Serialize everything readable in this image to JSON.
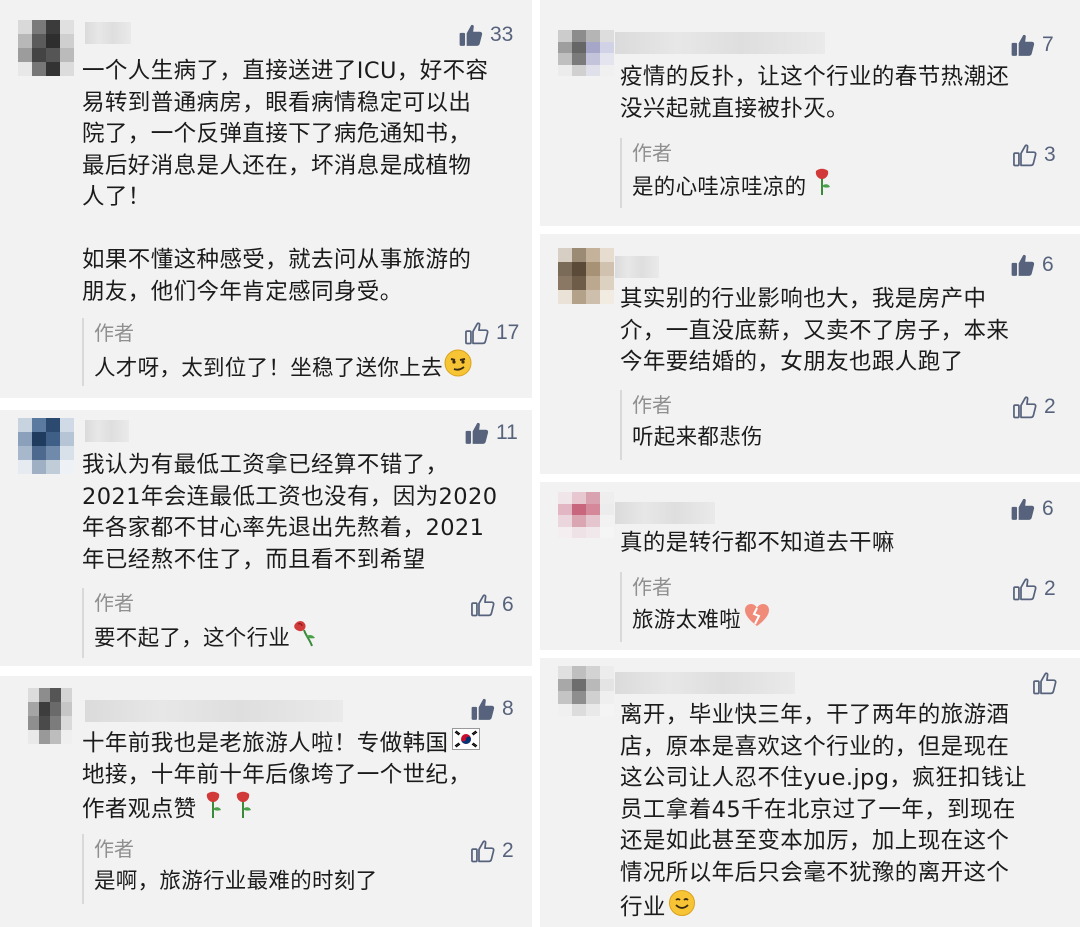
{
  "comments": [
    {
      "likes": "33",
      "lines": [
        "一个人生病了，直接送进了ICU，好不容",
        "易转到普通病房，眼看病情稳定可以出",
        "院了，一个反弹直接下了病危通知书，",
        "最后好消息是人还在，坏消息是成植物",
        "人了！",
        "",
        "如果不懂这种感受，就去问从事旅游的",
        "朋友，他们今年肯定感同身受。"
      ],
      "reply": {
        "author": "作者",
        "text": "人才呀，太到位了！坐稳了送你上去",
        "likes": "17"
      }
    },
    {
      "likes": "11",
      "lines": [
        "我认为有最低工资拿已经算不错了，",
        "2021年会连最低工资也没有，因为2020",
        "年各家都不甘心率先退出先熬着，2021",
        "年已经熬不住了，而且看不到希望"
      ],
      "reply": {
        "author": "作者",
        "text": "要不起了，这个行业",
        "likes": "6"
      }
    },
    {
      "likes": "8",
      "lines": [
        "十年前我也是老旅游人啦！专做韩国",
        "地接，十年前十年后像垮了一个世纪，",
        "作者观点赞"
      ],
      "reply": {
        "author": "作者",
        "text": "是啊，旅游行业最难的时刻了",
        "likes": "2"
      }
    },
    {
      "likes": "7",
      "lines": [
        "疫情的反扑，让这个行业的春节热潮还",
        "没兴起就直接被扑灭。"
      ],
      "reply": {
        "author": "作者",
        "text": "是的心哇凉哇凉的",
        "likes": "3"
      }
    },
    {
      "likes": "6",
      "lines": [
        "其实别的行业影响也大，我是房产中",
        "介，一直没底薪，又卖不了房子，本来",
        "今年要结婚的，女朋友也跟人跑了"
      ],
      "reply": {
        "author": "作者",
        "text": "听起来都悲伤",
        "likes": "2"
      }
    },
    {
      "likes": "6",
      "lines": [
        "真的是转行都不知道去干嘛"
      ],
      "reply": {
        "author": "作者",
        "text": "旅游太难啦",
        "likes": "2"
      }
    },
    {
      "likes": "",
      "lines": [
        "离开，毕业快三年，干了两年的旅游酒",
        "店，原本是喜欢这个行业的，但是现在",
        "这公司让人忍不住yue.jpg，疯狂扣钱让",
        "员工拿着45千在北京过了一年，到现在",
        "还是如此甚至变本加厉，加上现在这个",
        "情况所以年后只会毫不犹豫的离开这个",
        "行业"
      ],
      "reply": null
    }
  ],
  "colors": {
    "card_bg": "#f2f2f2",
    "like_blue": "#57637c",
    "reply_author": "#8f8f8f"
  },
  "icons": {
    "like": "thumbs-up-icon",
    "like_outline": "thumbs-up-outline-icon"
  }
}
